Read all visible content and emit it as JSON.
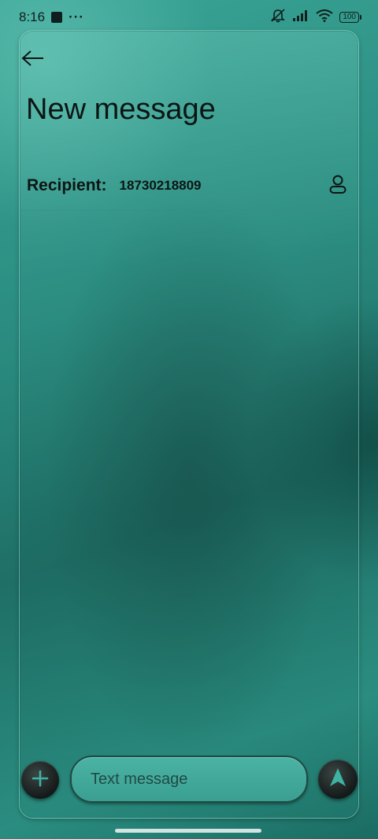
{
  "status_bar": {
    "time": "8:16",
    "more": "···",
    "battery": "100"
  },
  "header": {
    "title": "New message"
  },
  "recipient": {
    "label": "Recipient:",
    "value": "18730218809"
  },
  "compose": {
    "placeholder": "Text message"
  },
  "colors": {
    "accent": "#3a9f91",
    "background": "#2a8c80",
    "button_dark": "#141a19"
  },
  "icons": {
    "back": "back-arrow-icon",
    "contact": "contact-person-icon",
    "attach": "plus-icon",
    "send": "send-arrow-icon",
    "mute": "notifications-off-icon",
    "signal": "signal-icon",
    "wifi": "wifi-icon",
    "battery": "battery-icon"
  }
}
